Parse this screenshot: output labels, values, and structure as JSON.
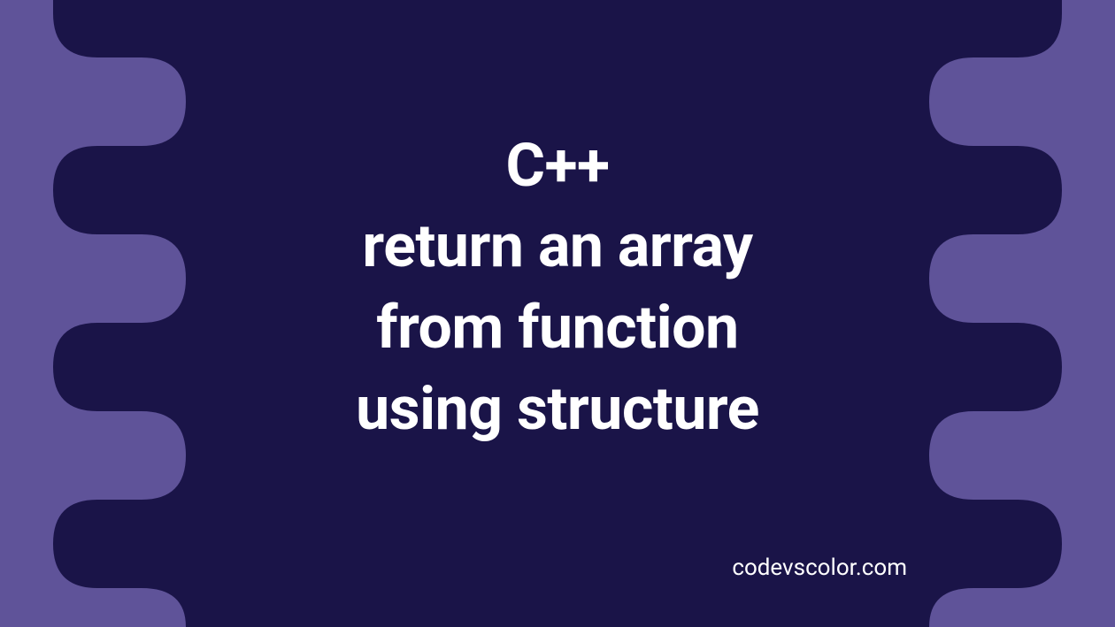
{
  "title": {
    "line1": "C++",
    "line2": "return an array",
    "line3": "from function",
    "line4": "using structure"
  },
  "watermark": "codevscolor.com",
  "colors": {
    "background_outer": "#5f5399",
    "background_inner": "#1a1448",
    "text": "#ffffff"
  }
}
